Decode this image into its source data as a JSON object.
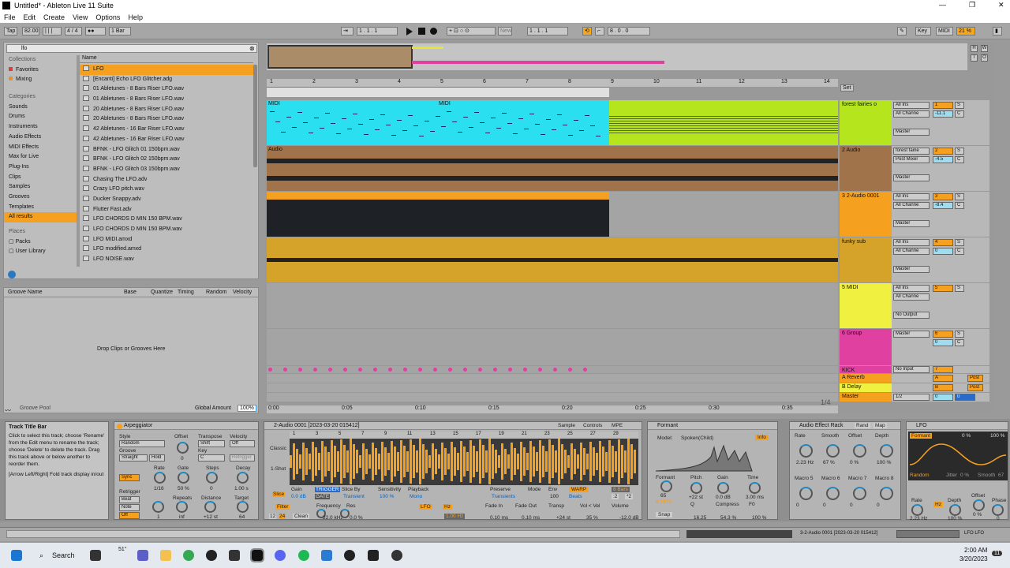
{
  "window": {
    "title": "Untitled* - Ableton Live 11 Suite",
    "controls": [
      "—",
      "❐",
      "✕"
    ]
  },
  "menu": [
    "File",
    "Edit",
    "Create",
    "View",
    "Options",
    "Help"
  ],
  "transport": {
    "tap": "Tap",
    "tempo": "82.00",
    "signature": "4 / 4",
    "quantize": "1 Bar",
    "position": "1 .  1 .  1",
    "loop_start": "1 .  1 .  1",
    "loop_length": "8 .  0 .  0",
    "new_label": "New",
    "key_label": "Key",
    "midi_label": "MIDI",
    "cpu": "21 %"
  },
  "browser": {
    "search_value": "lfo",
    "collections_header": "Collections",
    "collections": [
      {
        "label": "Favorites",
        "color": "#e03a3a"
      },
      {
        "label": "Mixing",
        "color": "#e8902a"
      }
    ],
    "categories_header": "Categories",
    "categories": [
      "Sounds",
      "Drums",
      "Instruments",
      "Audio Effects",
      "MIDI Effects",
      "Max for Live",
      "Plug-Ins",
      "Clips",
      "Samples",
      "Grooves",
      "Templates",
      "All results"
    ],
    "places_header": "Places",
    "places": [
      "Packs",
      "User Library"
    ],
    "name_header": "Name",
    "files": [
      "LFO",
      "[Encanti] Echo LFO Glitcher.adg",
      "01 Abletunes - 8 Bars Riser LFO.wav",
      "01 Abletunes - 8 Bars Riser LFO.wav",
      "20 Abletunes - 8 Bars Riser LFO.wav",
      "20 Abletunes - 8 Bars Riser LFO.wav",
      "42 Abletunes - 16 Bar Riser LFO.wav",
      "42 Abletunes - 16 Bar Riser LFO.wav",
      "BFNK - LFO Glitch 01 150bpm.wav",
      "BFNK - LFO Glitch 02 150bpm.wav",
      "BFNK - LFO Glitch 03 150bpm.wav",
      "Chasing The LFO.adv",
      "Crazy LFO pitch.wav",
      "Ducker Snappy.adv",
      "Flutter Fast.adv",
      "LFO CHORDS D MIN 150 BPM.wav",
      "LFO CHORDS D MIN 150 BPM.wav",
      "LFO MIDI.amxd",
      "LFO modified.amxd",
      "LFO NOISE.wav"
    ]
  },
  "groove": {
    "columns": [
      "Groove Name",
      "Base",
      "Quantize",
      "Timing",
      "Random",
      "Velocity"
    ],
    "empty_text": "Drop Clips or Grooves Here",
    "pool_label": "Groove Pool",
    "global_amount_label": "Global Amount",
    "global_amount": "100%"
  },
  "arrangement": {
    "bars": [
      "1",
      "2",
      "3",
      "4",
      "5",
      "6",
      "7",
      "8",
      "9",
      "10",
      "11",
      "12",
      "13",
      "14"
    ],
    "times": [
      "0:00",
      "0:05",
      "0:10",
      "0:15",
      "0:20",
      "0:25",
      "0:30",
      "0:35"
    ],
    "page": "1/4",
    "set_label": "Set",
    "tracks": [
      {
        "name": "forest fairies o",
        "color": "#b5e61d",
        "clip_color": "#2ae0f0",
        "clip_names": [
          "MIDI",
          "MIDI"
        ],
        "num": "1",
        "vol": "-11.1",
        "pan": "C",
        "input": "All Ins",
        "channel": "All Channe",
        "output": "Master"
      },
      {
        "name": "2 Audio",
        "color": "#a0734b",
        "clip_color": "#a0734b",
        "clip_names": [
          "Audio"
        ],
        "num": "2",
        "vol": "-4.5",
        "pan": "C",
        "input": "forest fairie",
        "channel": "Post Mixer",
        "output": "Master"
      },
      {
        "name": "3 2-Audio 0001",
        "color": "#f6a020",
        "clip_color": "#1a1a1a",
        "clip_names": [],
        "num": "3",
        "vol": "-8.4",
        "pan": "C",
        "input": "All Ins",
        "channel": "All Channe",
        "output": "Master"
      },
      {
        "name": "funky sub",
        "color": "#d5a22a",
        "clip_color": "#d5a22a",
        "clip_names": [],
        "num": "4",
        "vol": "0",
        "pan": "C",
        "input": "All Ins",
        "channel": "All Channe",
        "output": "Master"
      },
      {
        "name": "5 MIDI",
        "color": "#f0f040",
        "clip_color": "#999",
        "clip_names": [],
        "num": "5",
        "vol": "",
        "pan": "",
        "input": "All Ins",
        "channel": "All Channe",
        "output": "No Output"
      },
      {
        "name": "6 Group",
        "color": "#e040a0",
        "clip_color": "#999",
        "clip_names": [],
        "num": "6",
        "vol": "0",
        "pan": "C",
        "input": "Master",
        "channel": "",
        "output": ""
      },
      {
        "name": "KICK",
        "color": "#e040a0",
        "clip_color": "#999",
        "clip_names": [],
        "num": "7",
        "vol": "",
        "pan": "",
        "input": "No Input",
        "channel": "",
        "output": ""
      }
    ],
    "returns": [
      {
        "name": "A Reverb",
        "num": "A",
        "post": "Post"
      },
      {
        "name": "B Delay",
        "num": "B",
        "post": "Post"
      }
    ],
    "master": {
      "name": "Master",
      "num": "0",
      "out": "1/2",
      "vol": "0"
    },
    "io": {
      "auto": "Auto",
      "off": "Off",
      "in": "In",
      "inf": "-inf"
    }
  },
  "info_view": {
    "title": "Track Title Bar",
    "text": "Click to select this track; choose 'Rename' from the Edit menu to rename the track; choose 'Delete' to delete the track. Drag this track above or below another to reorder them.",
    "hint": "[Arrow Left/Right] Fold track display in/out"
  },
  "arpeggiator": {
    "title": "Arpeggiator",
    "style_label": "Style",
    "style_value": "Random",
    "groove_label": "Groove",
    "groove_value": "Straight",
    "hold_label": "Hold",
    "offset_label": "Offset",
    "offset_value": "0",
    "transpose_label": "Transpose",
    "transpose_value": "Shift",
    "key_label": "Key",
    "key_value": "C",
    "velocity_label": "Velocity",
    "velocity_value": "Off",
    "sync_label": "Sync",
    "rate_label": "Rate",
    "rate_value": "1/16",
    "gate_label": "Gate",
    "gate_value": "50 %",
    "steps_label": "Steps",
    "steps_value": "0",
    "decay_label": "Decay",
    "decay_value": "1.00 s",
    "retrigger_label": "Retrigger",
    "retrigger_value": "Retrigger",
    "retrig_options": [
      "Beat",
      "Note",
      "Off"
    ],
    "retrig_value": "1",
    "repeats_label": "Repeats",
    "repeats_value": "inf",
    "distance_label": "Distance",
    "distance_value": "+12 st",
    "target_label": "Target",
    "target_value": "64"
  },
  "clip": {
    "title": "2-Audio 0001 [2023-03-20 015412]",
    "tabs": [
      "Sample",
      "Controls",
      "MPE"
    ],
    "classic": "Classic",
    "oneshot": "1-Shot",
    "slice": "Slice",
    "gain_label": "Gain",
    "gain_value": "0.0 dB",
    "trigger": "TRIGGER",
    "gate": "GATE",
    "sliceby_label": "Slice By",
    "sliceby_value": "Transient",
    "sensitivity_label": "Sensitivity",
    "sensitivity_value": "100 %",
    "playback_label": "Playback",
    "playback_value": "Mono",
    "preserve_label": "Preserve",
    "preserve_value": "Transients",
    "mode_label": "Mode",
    "env_label": "Env",
    "env_value": "100",
    "warp": "WARP",
    "length": "8 Bars",
    "beats": "Beats",
    "halve": ":2",
    "double": "*2",
    "filter": "Filter",
    "frequency_label": "Frequency",
    "res_label": "Res",
    "freq_value": "22.0 kHz",
    "res_value": "0.0 %",
    "clean": "Clean",
    "n12": "12",
    "n24": "24",
    "lfo": "LFO",
    "hz": "Hz",
    "lfo_rate": "1.00 Hz",
    "fadein_label": "Fade In",
    "fadeout_label": "Fade Out",
    "fadein_value": "0.10 ms",
    "fadeout_value": "0.10 ms",
    "transp_label": "Transp",
    "transp_value": "+24 st",
    "vol_vel_label": "Vol < Vel",
    "vol_vel_value": "35 %",
    "volume_label": "Volume",
    "volume_value": "-12.0 dB",
    "ruler": [
      "1",
      "3",
      "5",
      "7",
      "9",
      "11",
      "13",
      "15",
      "17",
      "19",
      "21",
      "23",
      "25",
      "27",
      "29"
    ]
  },
  "formant": {
    "title": "Formant",
    "model_label": "Model:",
    "model_value": "Spoken(Child)",
    "info": "Info",
    "formant_label": "Formant",
    "formant_value": "8.1973",
    "pitch_label": "Pitch",
    "pitch_value": "+22 st",
    "gain_label": "Gain",
    "gain_value": "0.0 dB",
    "time_label": "Time",
    "time_value": "3.00 ms",
    "snap": "Snap",
    "q_label": "Q",
    "q_value": "16.25",
    "compress_label": "Compress",
    "compress_value": "54.3 %",
    "f0_label": "F0",
    "f0_value": "100 %",
    "number": "65"
  },
  "rack": {
    "title": "Audio Effect Rack",
    "rand": "Rand",
    "map": "Map",
    "macros": [
      {
        "label": "Rate",
        "value": "2.23 Hz"
      },
      {
        "label": "Smooth",
        "value": "67 %"
      },
      {
        "label": "Offset",
        "value": "0 %"
      },
      {
        "label": "Depth",
        "value": "100 %"
      },
      {
        "label": "Macro 5",
        "value": "0"
      },
      {
        "label": "Macro 6",
        "value": "0"
      },
      {
        "label": "Macro 7",
        "value": "0"
      },
      {
        "label": "Macro 8",
        "value": "0"
      }
    ]
  },
  "lfo": {
    "title": "LFO",
    "formant": "Formant",
    "pct1": "0 %",
    "pct2": "100 %",
    "random": "Random",
    "jitter": "Jitter",
    "jitter_value": "0 %",
    "smooth": "Smooth",
    "smooth_value": "67",
    "rate_label": "Rate",
    "rate_value": "2.23 Hz",
    "depth_label": "Depth",
    "depth_value": "100 %",
    "offset_label": "Offset",
    "offset_value": "0 %",
    "phase_label": "Phase",
    "phase_value": "0",
    "hz": "Hz"
  },
  "status": {
    "left_text": "",
    "track": "3-2-Audio 0001 [2023-03-20 015412]",
    "device_path": "LFO LFO"
  },
  "taskbar": {
    "search": "Search",
    "weather": "51°",
    "time": "2:00 AM",
    "date": "3/20/2023",
    "notif": "11"
  }
}
